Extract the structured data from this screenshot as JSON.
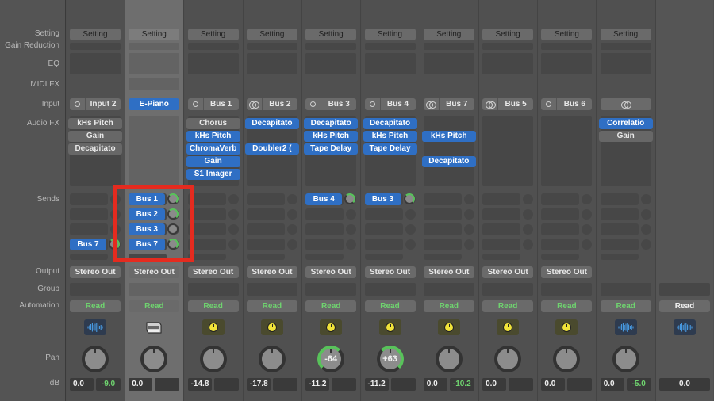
{
  "row_labels": {
    "setting": "Setting",
    "gain_reduction": "Gain Reduction",
    "eq": "EQ",
    "midi_fx": "MIDI FX",
    "input": "Input",
    "audio_fx": "Audio FX",
    "sends": "Sends",
    "output": "Output",
    "group": "Group",
    "automation": "Automation",
    "pan": "Pan",
    "db": "dB"
  },
  "colors": {
    "accent_blue": "#2f6fc4",
    "read_green": "#6fd46f",
    "highlight_red": "#e52b1f"
  },
  "strips": [
    {
      "setting": "Setting",
      "input": "Input 2",
      "input_icon": "mono-circle-icon",
      "audio_fx": [
        {
          "label": "kHs Pitch",
          "active": false
        },
        {
          "label": "Gain",
          "active": false
        },
        {
          "label": "Decapitato",
          "active": false
        }
      ],
      "sends": [
        {
          "label": "Bus 7",
          "slot": 3
        }
      ],
      "output": "Stereo Out",
      "automation": "Read",
      "track_icon": "waveform-icon",
      "pan": "",
      "db_left": "0.0",
      "db_right": "-9.0"
    },
    {
      "setting": "Setting",
      "input": "E-Piano",
      "input_icon": "instrument",
      "audio_fx": [],
      "sends": [
        {
          "label": "Bus 1",
          "slot": 0
        },
        {
          "label": "Bus 2",
          "slot": 1
        },
        {
          "label": "Bus 3",
          "slot": 2
        },
        {
          "label": "Bus 7",
          "slot": 3
        }
      ],
      "output": "Stereo Out",
      "automation": "Read",
      "track_icon": "piano-icon",
      "pan": "",
      "db_left": "0.0",
      "db_right": ""
    },
    {
      "setting": "Setting",
      "input": "Bus 1",
      "input_icon": "mono-circle-icon",
      "audio_fx": [
        {
          "label": "Chorus",
          "active": false
        },
        {
          "label": "kHs Pitch",
          "active": true
        },
        {
          "label": "ChromaVerb",
          "active": true
        },
        {
          "label": "Gain",
          "active": true
        },
        {
          "label": "S1 Imager",
          "active": true
        }
      ],
      "sends": [],
      "output": "Stereo Out",
      "automation": "Read",
      "track_icon": "aux-knob-icon",
      "pan": "",
      "db_left": "-14.8",
      "db_right": ""
    },
    {
      "setting": "Setting",
      "input": "Bus 2",
      "input_icon": "stereo-link-icon",
      "audio_fx": [
        {
          "label": "Decapitato",
          "active": true
        },
        null,
        {
          "label": "Doubler2 (",
          "active": true
        }
      ],
      "sends": [],
      "output": "Stereo Out",
      "automation": "Read",
      "track_icon": "aux-knob-icon",
      "pan": "",
      "db_left": "-17.8",
      "db_right": ""
    },
    {
      "setting": "Setting",
      "input": "Bus 3",
      "input_icon": "mono-circle-icon",
      "audio_fx": [
        {
          "label": "Decapitato",
          "active": true
        },
        {
          "label": "kHs Pitch",
          "active": true
        },
        {
          "label": "Tape Delay",
          "active": true
        }
      ],
      "sends": [
        {
          "label": "Bus 4",
          "slot": 0
        }
      ],
      "output": "Stereo Out",
      "automation": "Read",
      "track_icon": "aux-knob-icon",
      "pan": "-64",
      "db_left": "-11.2",
      "db_right": ""
    },
    {
      "setting": "Setting",
      "input": "Bus 4",
      "input_icon": "mono-circle-icon",
      "audio_fx": [
        {
          "label": "Decapitato",
          "active": true
        },
        {
          "label": "kHs Pitch",
          "active": true
        },
        {
          "label": "Tape Delay",
          "active": true
        }
      ],
      "sends": [
        {
          "label": "Bus 3",
          "slot": 0
        }
      ],
      "output": "Stereo Out",
      "automation": "Read",
      "track_icon": "aux-knob-icon",
      "pan": "+63",
      "db_left": "-11.2",
      "db_right": ""
    },
    {
      "setting": "Setting",
      "input": "Bus 7",
      "input_icon": "stereo-link-icon",
      "audio_fx": [
        null,
        {
          "label": "kHs Pitch",
          "active": true
        },
        null,
        {
          "label": "Decapitato",
          "active": true
        }
      ],
      "sends": [],
      "output": "Stereo Out",
      "automation": "Read",
      "track_icon": "aux-knob-icon",
      "pan": "",
      "db_left": "0.0",
      "db_right": "-10.2"
    },
    {
      "setting": "Setting",
      "input": "Bus 5",
      "input_icon": "stereo-link-icon",
      "audio_fx": [],
      "sends": [],
      "output": "Stereo Out",
      "automation": "Read",
      "track_icon": "aux-knob-icon",
      "pan": "",
      "db_left": "0.0",
      "db_right": ""
    },
    {
      "setting": "Setting",
      "input": "Bus 6",
      "input_icon": "mono-circle-icon",
      "audio_fx": [],
      "sends": [],
      "output": "Stereo Out",
      "automation": "Read",
      "track_icon": "aux-knob-icon",
      "pan": "",
      "db_left": "0.0",
      "db_right": ""
    },
    {
      "setting": "Setting",
      "input": "",
      "input_icon": "stereo-link-icon",
      "audio_fx": [
        {
          "label": "Correlatio",
          "active": true
        },
        {
          "label": "Gain",
          "active": false
        }
      ],
      "sends": [],
      "output": "",
      "automation": "Read",
      "track_icon": "waveform-icon",
      "pan": "",
      "db_left": "0.0",
      "db_right": "-5.0"
    },
    {
      "setting": "",
      "input": null,
      "audio_fx": [],
      "sends": [],
      "output": "",
      "automation": "Read",
      "automation_white": true,
      "track_icon": "waveform-icon",
      "pan": null,
      "db_full": "0.0"
    }
  ]
}
